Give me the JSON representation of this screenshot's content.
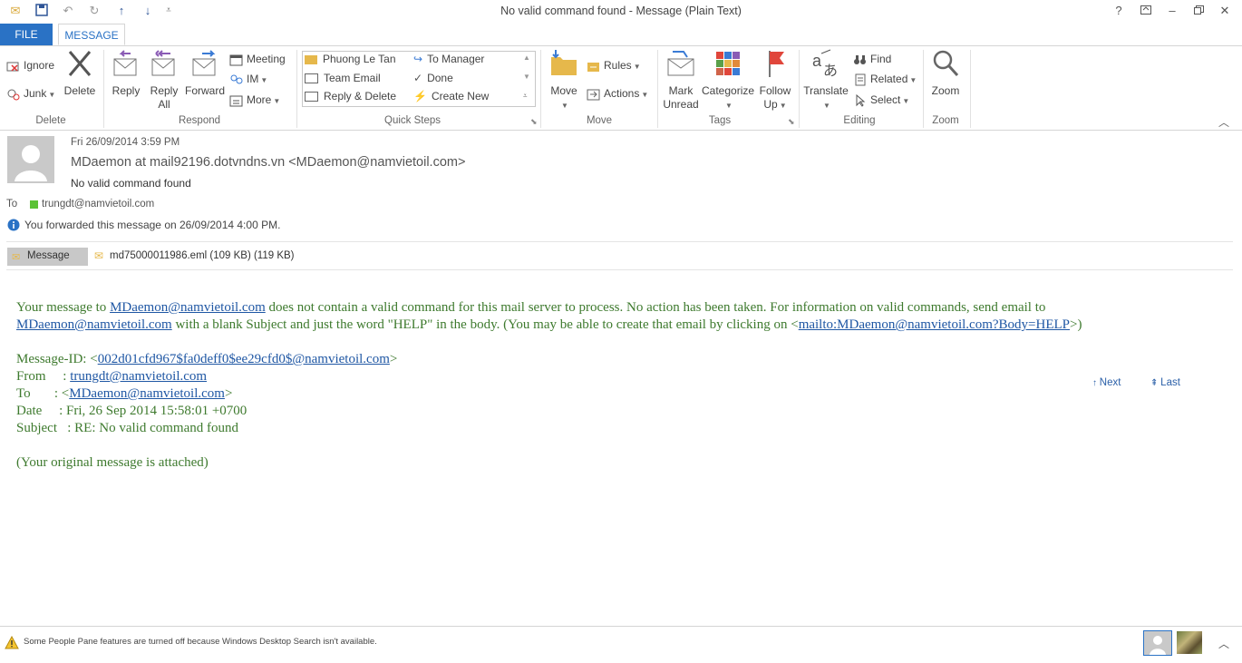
{
  "window": {
    "title": "No valid command found - Message (Plain Text)",
    "help": "?",
    "controls": [
      "?",
      "⧉",
      "–",
      "❐",
      "✕"
    ]
  },
  "tabs": {
    "file": "FILE",
    "message": "MESSAGE"
  },
  "ribbon": {
    "delete_group": {
      "label": "Delete",
      "ignore": "Ignore",
      "junk": "Junk",
      "delete": "Delete"
    },
    "respond_group": {
      "label": "Respond",
      "reply": "Reply",
      "reply_all_1": "Reply",
      "reply_all_2": "All",
      "forward": "Forward",
      "meeting": "Meeting",
      "im": "IM",
      "more": "More"
    },
    "quick_steps": {
      "label": "Quick Steps",
      "items": [
        "Phuong Le Tan",
        "Team Email",
        "Reply & Delete",
        "To Manager",
        "Done",
        "Create New"
      ]
    },
    "move_group": {
      "label": "Move",
      "move": "Move",
      "rules": "Rules",
      "actions": "Actions"
    },
    "tags_group": {
      "label": "Tags",
      "mark_unread_1": "Mark",
      "mark_unread_2": "Unread",
      "categorize": "Categorize",
      "follow_up_1": "Follow",
      "follow_up_2": "Up"
    },
    "editing_group": {
      "label": "Editing",
      "translate": "Translate",
      "find": "Find",
      "related": "Related",
      "select": "Select"
    },
    "zoom_group": {
      "label": "Zoom",
      "zoom": "Zoom"
    },
    "colors": {
      "accent": "#2a72c5",
      "flag": "#e0463b"
    }
  },
  "message_header": {
    "date": "Fri 26/09/2014 3:59 PM",
    "from": "MDaemon at mail92196.dotvndns.vn <MDaemon@namvietoil.com>",
    "subject": "No valid command found",
    "to_label": "To",
    "to": "trungdt@namvietoil.com",
    "info": "You forwarded this message on 26/09/2014 4:00 PM.",
    "attachments": {
      "message_tab": "Message",
      "file": "md75000011986.eml (109 KB) (119 KB)"
    }
  },
  "body": {
    "l1_a": "Your message to ",
    "l1_link": "MDaemon@namvietoil.com",
    "l1_b": " does not contain a valid command for this mail server to process.  No action has been taken.  For information on valid commands, send email to",
    "l2_link": "MDaemon@namvietoil.com",
    "l2_a": " with a blank Subject and just the word \"HELP\" in the body.  (You may be able to create that email by clicking on <",
    "l2_link2": "mailto:MDaemon@namvietoil.com?Body=HELP",
    "l2_b": ">)",
    "msgid_label": "Message-ID: <",
    "msgid_link": "002d01cfd967$fa0deff0$ee29cfd0$@namvietoil.com",
    "msgid_end": ">",
    "from_label": "From     : ",
    "from_link": "trungdt@namvietoil.com",
    "to_label": "To       : <",
    "to_link": "MDaemon@namvietoil.com",
    "to_end": ">",
    "date_line": "Date     : Fri, 26 Sep 2014 15:58:01 +0700",
    "subject_line": "Subject   : RE: No valid command found",
    "attached_line": "(Your original message is attached)",
    "nav_next": "Next",
    "nav_last": "Last"
  },
  "status": {
    "text": "Some People Pane features are turned off because Windows Desktop Search isn't available."
  }
}
